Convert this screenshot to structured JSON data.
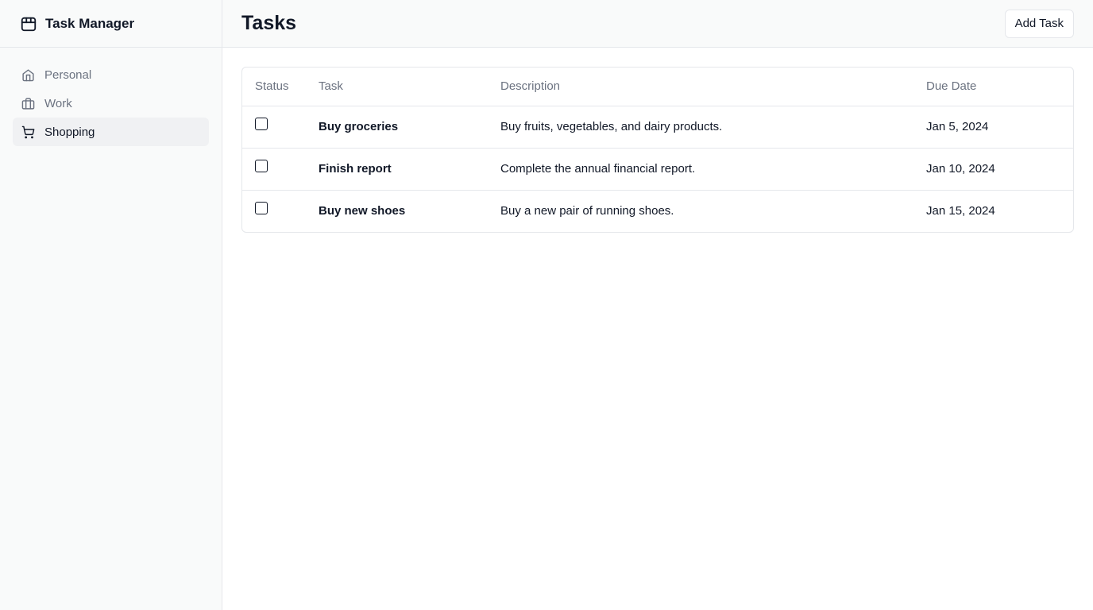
{
  "sidebar": {
    "brand": {
      "icon": "package-icon",
      "title": "Task Manager"
    },
    "items": [
      {
        "icon": "home-icon",
        "label": "Personal",
        "active": false
      },
      {
        "icon": "briefcase-icon",
        "label": "Work",
        "active": false
      },
      {
        "icon": "shopping-cart-icon",
        "label": "Shopping",
        "active": true
      }
    ]
  },
  "header": {
    "title": "Tasks",
    "add_button_label": "Add Task"
  },
  "table": {
    "columns": [
      "Status",
      "Task",
      "Description",
      "Due Date"
    ],
    "rows": [
      {
        "checked": false,
        "task": "Buy groceries",
        "description": "Buy fruits, vegetables, and dairy products.",
        "due": "Jan 5, 2024"
      },
      {
        "checked": false,
        "task": "Finish report",
        "description": "Complete the annual financial report.",
        "due": "Jan 10, 2024"
      },
      {
        "checked": false,
        "task": "Buy new shoes",
        "description": "Buy a new pair of running shoes.",
        "due": "Jan 15, 2024"
      }
    ]
  },
  "colors": {
    "sidebar_bg": "#f9fafa",
    "active_item_bg": "#f0f1f3",
    "border": "#e5e7eb",
    "muted_text": "#6b7280",
    "text": "#111827"
  }
}
